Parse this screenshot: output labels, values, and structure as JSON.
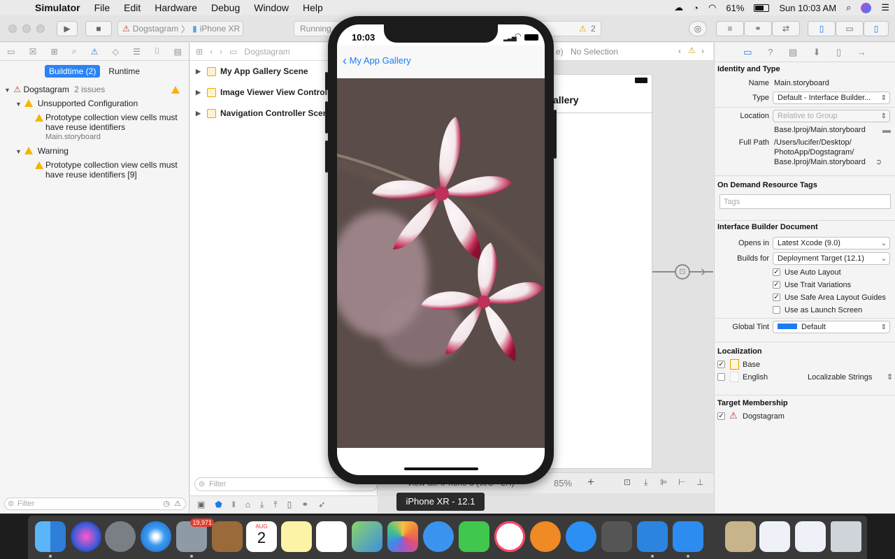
{
  "menubar": {
    "items": [
      "Simulator",
      "File",
      "Edit",
      "Hardware",
      "Debug",
      "Window",
      "Help"
    ],
    "battery": "61%",
    "clock": "Sun 10:03 AM"
  },
  "toolbar": {
    "scheme_target": "Dogstagram",
    "device": "iPhone XR",
    "activity": "Running",
    "warning_count": "2"
  },
  "navigator": {
    "tabs": [
      "Buildtime (2)",
      "Runtime"
    ],
    "project": "Dogstagram",
    "project_issues": "2 issues",
    "group1": "Unsupported Configuration",
    "issue1_line1": "Prototype collection view cells must",
    "issue1_line2": "have reuse identifiers",
    "issue1_file": "Main.storyboard",
    "group2": "Warning",
    "issue2_line1": "Prototype collection view cells must",
    "issue2_line2": "have reuse identifiers [9]",
    "filter_placeholder": "Filter"
  },
  "outline": {
    "breadcrumb": "Dogstagram",
    "scenes": [
      "My App Gallery Scene",
      "Image Viewer View Controlle",
      "Navigation Controller Scene"
    ],
    "filter_placeholder": "Filter"
  },
  "canvas": {
    "selection": "No Selection",
    "scene_title_fragment": "allery",
    "view_as": "View as: iPhone 8 (⌘C ⌥R)",
    "zoom": "85%"
  },
  "inspector": {
    "identity_header": "Identity and Type",
    "name_label": "Name",
    "name_value": "Main.storyboard",
    "type_label": "Type",
    "type_value": "Default - Interface Builder...",
    "location_label": "Location",
    "location_value": "Relative to Group",
    "location_path": "Base.lproj/Main.storyboard",
    "fullpath_label": "Full Path",
    "fullpath_line1": "/Users/lucifer/Desktop/",
    "fullpath_line2": "PhotoApp/Dogstagram/",
    "fullpath_line3": "Base.lproj/Main.storyboard",
    "odr_header": "On Demand Resource Tags",
    "tags_placeholder": "Tags",
    "ibdoc_header": "Interface Builder Document",
    "opens_in_label": "Opens in",
    "opens_in_value": "Latest Xcode (9.0)",
    "builds_for_label": "Builds for",
    "builds_for_value": "Deployment Target (12.1)",
    "opt_autolayout": "Use Auto Layout",
    "opt_trait": "Use Trait Variations",
    "opt_safearea": "Use Safe Area Layout Guides",
    "opt_launch": "Use as Launch Screen",
    "tint_label": "Global Tint",
    "tint_value": "Default",
    "tint_color": "#1a7cf5",
    "loc_header": "Localization",
    "loc_base": "Base",
    "loc_english": "English",
    "loc_english_type": "Localizable Strings",
    "target_header": "Target Membership",
    "target_name": "Dogstagram"
  },
  "simulator": {
    "time": "10:03",
    "back_title": "My App Gallery",
    "device_tooltip": "iPhone XR - 12.1"
  },
  "dock": {
    "mail_badge": "19,971",
    "calendar_month": "AUG",
    "calendar_day": "2"
  }
}
